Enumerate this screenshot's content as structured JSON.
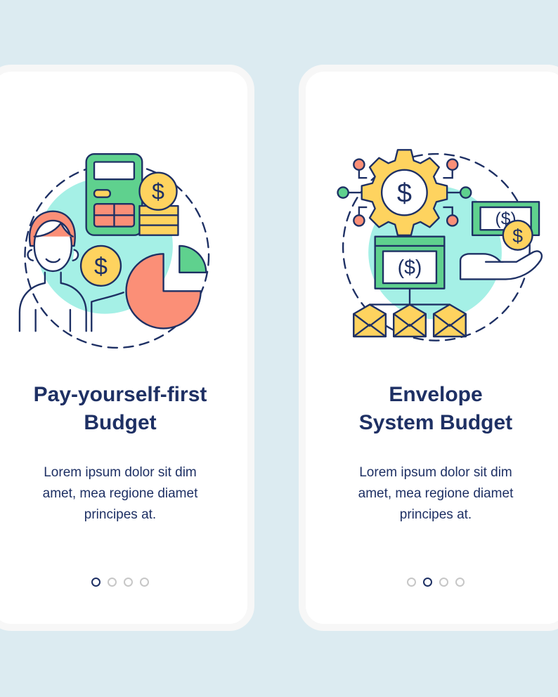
{
  "cards": [
    {
      "title_lines": [
        "Pay-yourself-first",
        "Budget"
      ],
      "body_lines": [
        "Lorem ipsum dolor sit dim",
        "amet, mea regione diamet",
        "principes at."
      ],
      "illustration_icon": "pay-yourself-first-illustration",
      "active_page": 1,
      "page_count": 4
    },
    {
      "title_lines": [
        "Envelope",
        "System Budget"
      ],
      "body_lines": [
        "Lorem ipsum dolor sit dim",
        "amet, mea regione diamet",
        "principes at."
      ],
      "illustration_icon": "envelope-system-illustration",
      "active_page": 2,
      "page_count": 4
    }
  ],
  "colors": {
    "background": "#dcebf1",
    "card": "#ffffff",
    "navy": "#1e3064",
    "teal": "#a5f0e6",
    "green": "#5fd18e",
    "yellow": "#fed35f",
    "salmon": "#fb8f77",
    "dot_inactive": "#c7c7c7"
  }
}
